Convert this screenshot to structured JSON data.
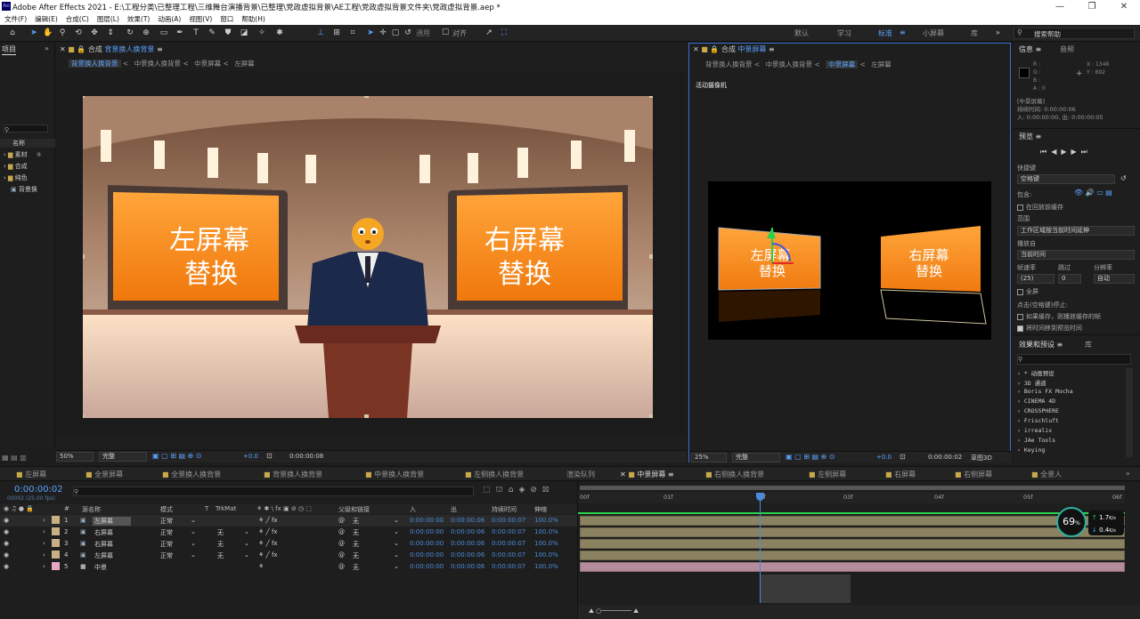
{
  "window": {
    "app_icon": "Ae",
    "title": "Adobe After Effects 2021 - E:\\工程分类\\已整理工程\\三维舞台演播背景\\已整理\\党政虚拟背景\\AE工程\\党政虚拟背景文件夹\\党政虚拟背景.aep *"
  },
  "menu": [
    "文件(F)",
    "编辑(E)",
    "合成(C)",
    "图层(L)",
    "效果(T)",
    "动画(A)",
    "视图(V)",
    "窗口",
    "帮助(H)"
  ],
  "toolbar": {
    "snap_label": "对齐",
    "default_label": "通用",
    "workspaces": [
      "默认",
      "学习",
      "标准",
      "小屏幕",
      "库"
    ],
    "search_placeholder": "搜索帮助"
  },
  "project": {
    "title": "项目",
    "col_name": "名称",
    "items": [
      "素材",
      "合成",
      "纯色",
      "背景换"
    ]
  },
  "comp_left": {
    "tab_title": "合成",
    "comp_name": "背景换人换背景",
    "crumbs": [
      "背景换人换背景",
      "中景换人换背景",
      "中景屏幕",
      "左屏幕"
    ],
    "left_screen_line1": "左屏幕",
    "left_screen_line2": "替换",
    "right_screen_line1": "右屏幕",
    "right_screen_line2": "替换",
    "zoom": "50%",
    "quality": "完整",
    "exposure": "+0.0",
    "timecode": "0:00:00:08"
  },
  "comp_right": {
    "tab_title": "合成",
    "comp_name": "中景屏幕",
    "crumbs": [
      "背景换人换背景",
      "中景换人换背景",
      "中景屏幕",
      "左屏幕"
    ],
    "camera_label": "活动摄像机",
    "left_line1": "左屏幕",
    "left_line2": "替换",
    "right_line1": "右屏幕",
    "right_line2": "替换",
    "zoom": "25%",
    "quality": "完整",
    "exposure": "+0.0",
    "timecode": "0:00:00:02",
    "draft": "草图3D"
  },
  "info": {
    "title": "信息",
    "audio": "音频",
    "r": "R :",
    "g": "G :",
    "b": "B :",
    "a": "A : 0",
    "x": "X : 1348",
    "y": "Y : 892",
    "layer": "[中景屏幕]",
    "duration": "持续时间: 0:00:00:06",
    "inout": "入: 0:00:00:00,  出: 0:00:00:05"
  },
  "preview": {
    "title": "预览",
    "shortcut_label": "快捷键",
    "shortcut_value": "空格键",
    "include_label": "包含:",
    "cache_label": "在回放前缓存",
    "range_label": "范围",
    "range_value": "工作区域按当前时间延伸",
    "playfrom_label": "播放自",
    "playfrom_value": "当前时间",
    "fps_label": "帧速率",
    "skip_label": "跳过",
    "res_label": "分辨率",
    "fps_value": "(25)",
    "skip_value": "0",
    "res_value": "自动",
    "fullscreen_label": "全屏",
    "stop_label": "点击(空格键)停止:",
    "cache_play_label": "如果缓存，则播放缓存的帧",
    "move_time_label": "将时间移到预览时间"
  },
  "effects": {
    "title": "效果和预设",
    "lib": "库",
    "items": [
      "* 动画预设",
      "3D 通道",
      "Boris FX Mocha",
      "CINEMA 4D",
      "CROSSPHERE",
      "Frischluft",
      "irrealix",
      "JAe Tools",
      "Keying"
    ]
  },
  "timeline": {
    "tabs": [
      "左屏幕",
      "全景屏幕",
      "全景换人换背景",
      "背景换人换背景",
      "中景换人换背景",
      "左侧换人换背景",
      "渲染队列",
      "中景屏幕",
      "右侧换人换背景",
      "左侧屏幕",
      "右屏幕",
      "右侧屏幕",
      "全景人"
    ],
    "timecode": "0:00:00:02",
    "frame_info": "00002 (25.00 fps)",
    "headers": {
      "num": "#",
      "source": "源名称",
      "mode": "模式",
      "t": "T",
      "trkmat": "TrkMat",
      "parent": "父级和链接",
      "in": "入",
      "out": "出",
      "dur": "持续时间",
      "stretch": "伸缩"
    },
    "layers": [
      {
        "num": "1",
        "name": "左屏幕",
        "mode": "正常",
        "trk": "",
        "parent": "无",
        "in": "0:00:00:00",
        "out": "0:00:00:06",
        "dur": "0:00:00:07",
        "stretch": "100.0%"
      },
      {
        "num": "2",
        "name": "右屏幕",
        "mode": "正常",
        "trk": "无",
        "parent": "无",
        "in": "0:00:00:00",
        "out": "0:00:00:06",
        "dur": "0:00:00:07",
        "stretch": "100.0%"
      },
      {
        "num": "3",
        "name": "右屏幕",
        "mode": "正常",
        "trk": "无",
        "parent": "无",
        "in": "0:00:00:00",
        "out": "0:00:00:06",
        "dur": "0:00:00:07",
        "stretch": "100.0%"
      },
      {
        "num": "4",
        "name": "左屏幕",
        "mode": "正常",
        "trk": "无",
        "parent": "无",
        "in": "0:00:00:00",
        "out": "0:00:00:06",
        "dur": "0:00:00:07",
        "stretch": "100.0%"
      },
      {
        "num": "5",
        "name": "中景",
        "mode": "",
        "trk": "",
        "parent": "无",
        "in": "0:00:00:00",
        "out": "0:00:00:06",
        "dur": "0:00:00:07",
        "stretch": "100.0%"
      }
    ],
    "ruler": [
      "00f",
      "01f",
      "02f",
      "03f",
      "04f",
      "05f",
      "06f"
    ],
    "perf": "69",
    "perf_unit": "%",
    "speed_up": "1.7",
    "speed_down": "0.4",
    "speed_unit": "K/s"
  }
}
